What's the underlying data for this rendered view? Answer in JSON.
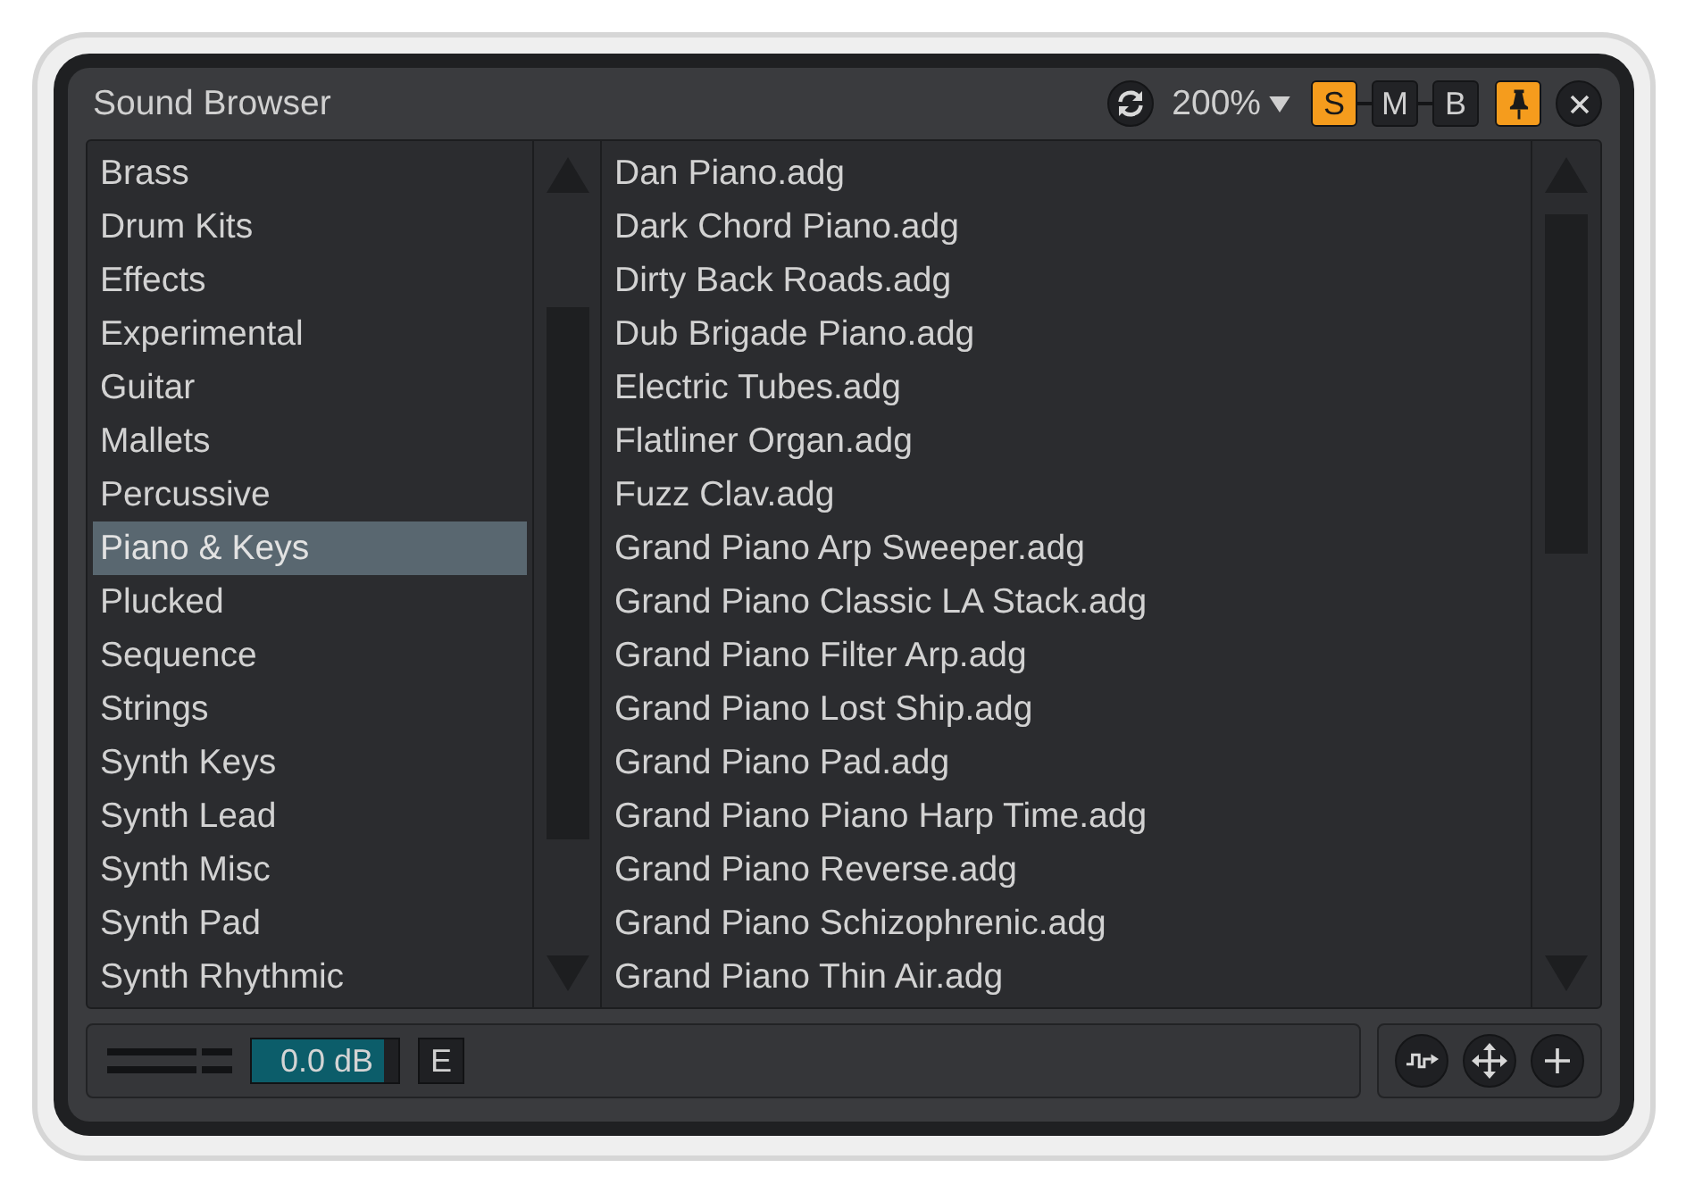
{
  "window": {
    "title": "Sound Browser"
  },
  "toolbar": {
    "zoom": "200%",
    "toggles": [
      {
        "label": "S",
        "on": true
      },
      {
        "label": "M",
        "on": false
      },
      {
        "label": "B",
        "on": false
      }
    ],
    "pin": {
      "on": true
    }
  },
  "categories": [
    {
      "label": "Brass",
      "selected": false
    },
    {
      "label": "Drum Kits",
      "selected": false
    },
    {
      "label": "Effects",
      "selected": false
    },
    {
      "label": "Experimental",
      "selected": false
    },
    {
      "label": "Guitar",
      "selected": false
    },
    {
      "label": "Mallets",
      "selected": false
    },
    {
      "label": "Percussive",
      "selected": false
    },
    {
      "label": "Piano & Keys",
      "selected": true
    },
    {
      "label": "Plucked",
      "selected": false
    },
    {
      "label": "Sequence",
      "selected": false
    },
    {
      "label": "Strings",
      "selected": false
    },
    {
      "label": "Synth Keys",
      "selected": false
    },
    {
      "label": "Synth Lead",
      "selected": false
    },
    {
      "label": "Synth Misc",
      "selected": false
    },
    {
      "label": "Synth Pad",
      "selected": false
    },
    {
      "label": "Synth Rhythmic",
      "selected": false
    }
  ],
  "files": [
    {
      "label": "Dan Piano.adg",
      "selected": false
    },
    {
      "label": "Dark Chord Piano.adg",
      "selected": false
    },
    {
      "label": "Dirty Back Roads.adg",
      "selected": false
    },
    {
      "label": "Dub Brigade Piano.adg",
      "selected": false
    },
    {
      "label": "Electric Tubes.adg",
      "selected": false
    },
    {
      "label": "Flatliner Organ.adg",
      "selected": false
    },
    {
      "label": "Fuzz Clav.adg",
      "selected": false
    },
    {
      "label": "Grand Piano Arp Sweeper.adg",
      "selected": false
    },
    {
      "label": "Grand Piano Classic LA Stack.adg",
      "selected": false
    },
    {
      "label": "Grand Piano Filter Arp.adg",
      "selected": false
    },
    {
      "label": "Grand Piano Lost Ship.adg",
      "selected": false
    },
    {
      "label": "Grand Piano Pad.adg",
      "selected": false
    },
    {
      "label": "Grand Piano Piano Harp Time.adg",
      "selected": false
    },
    {
      "label": "Grand Piano Reverse.adg",
      "selected": false
    },
    {
      "label": "Grand Piano Schizophrenic.adg",
      "selected": false
    },
    {
      "label": "Grand Piano Thin Air.adg",
      "selected": false
    }
  ],
  "footer": {
    "gain": {
      "value": "0.0 dB",
      "level": 0.9
    },
    "envelope_button": "E"
  }
}
